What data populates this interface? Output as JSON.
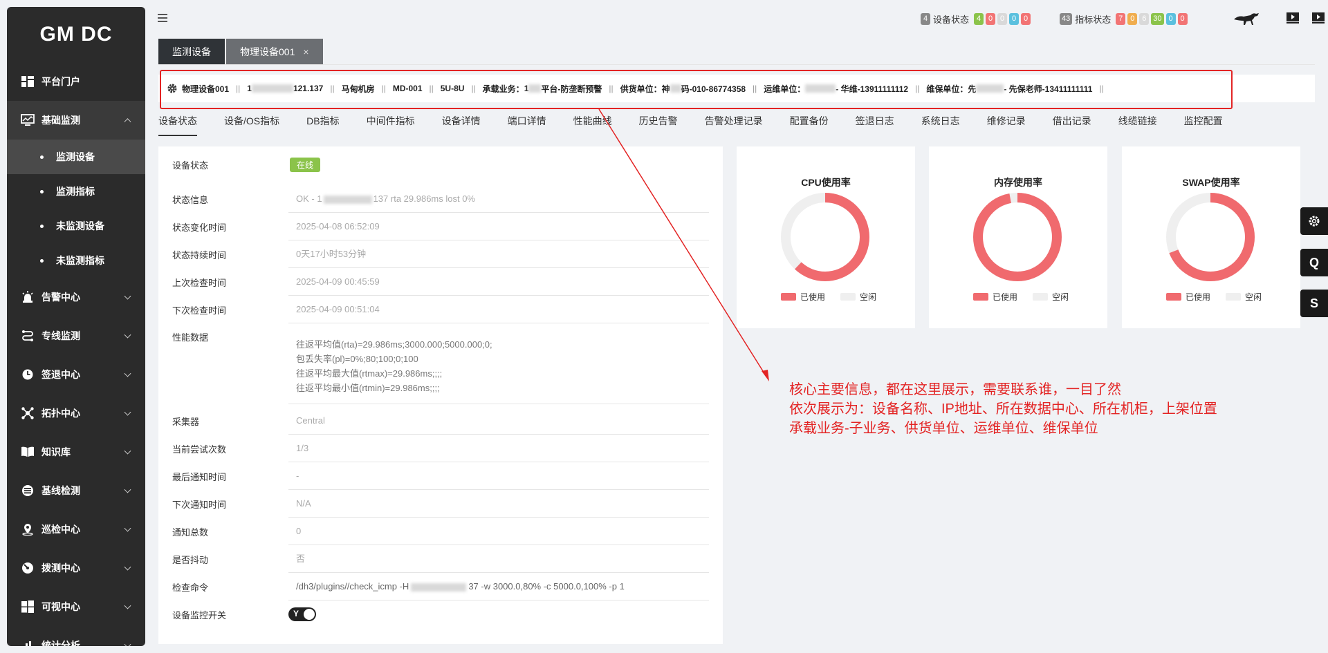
{
  "app": {
    "logo": "GM DC"
  },
  "sidebar": {
    "items": [
      {
        "label": "平台门户",
        "icon": "portal-icon"
      },
      {
        "label": "基础监测",
        "icon": "monitor-icon",
        "open": true,
        "children": [
          {
            "label": "监测设备",
            "active": true
          },
          {
            "label": "监测指标"
          },
          {
            "label": "未监测设备"
          },
          {
            "label": "未监测指标"
          }
        ]
      },
      {
        "label": "告警中心",
        "icon": "alarm-icon"
      },
      {
        "label": "专线监测",
        "icon": "line-icon"
      },
      {
        "label": "签退中心",
        "icon": "clock-icon"
      },
      {
        "label": "拓扑中心",
        "icon": "topology-icon"
      },
      {
        "label": "知识库",
        "icon": "book-icon"
      },
      {
        "label": "基线检测",
        "icon": "baseline-icon"
      },
      {
        "label": "巡检中心",
        "icon": "location-icon"
      },
      {
        "label": "拨测中心",
        "icon": "dial-icon"
      },
      {
        "label": "可视中心",
        "icon": "windows-icon"
      },
      {
        "label": "统计分析",
        "icon": "chart-icon"
      }
    ]
  },
  "topbar": {
    "device_status": {
      "total": "4",
      "label": "设备状态",
      "counts": [
        "4",
        "0",
        "0",
        "0",
        "0"
      ]
    },
    "metric_status": {
      "total": "43",
      "label": "指标状态",
      "counts": [
        "7",
        "0",
        "6",
        "30",
        "0",
        "0"
      ]
    },
    "colors": [
      "#8bc34a",
      "#f27474",
      "#d9d9d9",
      "#5bc0de",
      "#f27474"
    ]
  },
  "tabs": [
    {
      "label": "监测设备"
    },
    {
      "label": "物理设备001",
      "close": "×"
    }
  ],
  "info_bar": {
    "device_name": "物理设备001",
    "ip_prefix": "1",
    "ip_suffix": "121.137",
    "datacenter": "马甸机房",
    "cabinet": "MD-001",
    "position": "5U-8U",
    "business_label": "承载业务：",
    "business_prefix": "1",
    "business_value": "平台-防垄断预警",
    "supplier_label": "供货单位：",
    "supplier_prefix": "神",
    "supplier_value": "码-010-86774358",
    "ops_label": "运维单位：",
    "ops_value": "- 华维-13911111112",
    "maint_label": "维保单位：",
    "maint_prefix": "先",
    "maint_value": "- 先保老师-13411111111"
  },
  "subnav": [
    "设备状态",
    "设备/OS指标",
    "DB指标",
    "中间件指标",
    "设备详情",
    "端口详情",
    "性能曲线",
    "历史告警",
    "告警处理记录",
    "配置备份",
    "签退日志",
    "系统日志",
    "维修记录",
    "借出记录",
    "线缆链接",
    "监控配置"
  ],
  "status": {
    "device_status_label": "设备状态",
    "device_status_value": "在线",
    "status_info_label": "状态信息",
    "status_info_value": "OK - 1",
    "status_info_tail": "137 rta 29.986ms lost 0%",
    "change_time_label": "状态变化时间",
    "change_time_value": "2025-04-08 06:52:09",
    "duration_label": "状态持续时间",
    "duration_value": "0天17小时53分钟",
    "last_check_label": "上次检查时间",
    "last_check_value": "2025-04-09 00:45:59",
    "next_check_label": "下次检查时间",
    "next_check_value": "2025-04-09 00:51:04",
    "perf_label": "性能数据",
    "perf_lines": [
      "往返平均值(rta)=29.986ms;3000.000;5000.000;0;",
      "包丢失率(pl)=0%;80;100;0;100",
      "往返平均最大值(rtmax)=29.986ms;;;;",
      "往返平均最小值(rtmin)=29.986ms;;;;"
    ],
    "collector_label": "采集器",
    "collector_value": "Central",
    "attempts_label": "当前尝试次数",
    "attempts_value": "1/3",
    "last_notify_label": "最后通知时间",
    "last_notify_value": "-",
    "next_notify_label": "下次通知时间",
    "next_notify_value": "N/A",
    "notify_total_label": "通知总数",
    "notify_total_value": "0",
    "flapping_label": "是否抖动",
    "flapping_value": "否",
    "command_label": "检查命令",
    "command_prefix": "/dh3/plugins//check_icmp -H",
    "command_value": "37 -w 3000.0,80% -c 5000.0,100% -p 1",
    "switch_label": "设备监控开关",
    "switch_value": "Y"
  },
  "gauges": [
    {
      "title": "CPU使用率",
      "used": 0.62
    },
    {
      "title": "内存使用率",
      "used": 0.97
    },
    {
      "title": "SWAP使用率",
      "used": 0.69
    }
  ],
  "gauge_legend": {
    "used": "已使用",
    "free": "空闲",
    "used_color": "#f06a6e",
    "free_color": "#efefef"
  },
  "float_buttons": [
    "gear-icon",
    "Q",
    "S"
  ],
  "annotation": [
    "核心主要信息，都在这里展示，需要联系谁，一目了然",
    "依次展示为：设备名称、IP地址、所在数据中心、所在机柜，上架位置",
    "承载业务-子业务、供货单位、运维单位、维保单位"
  ]
}
